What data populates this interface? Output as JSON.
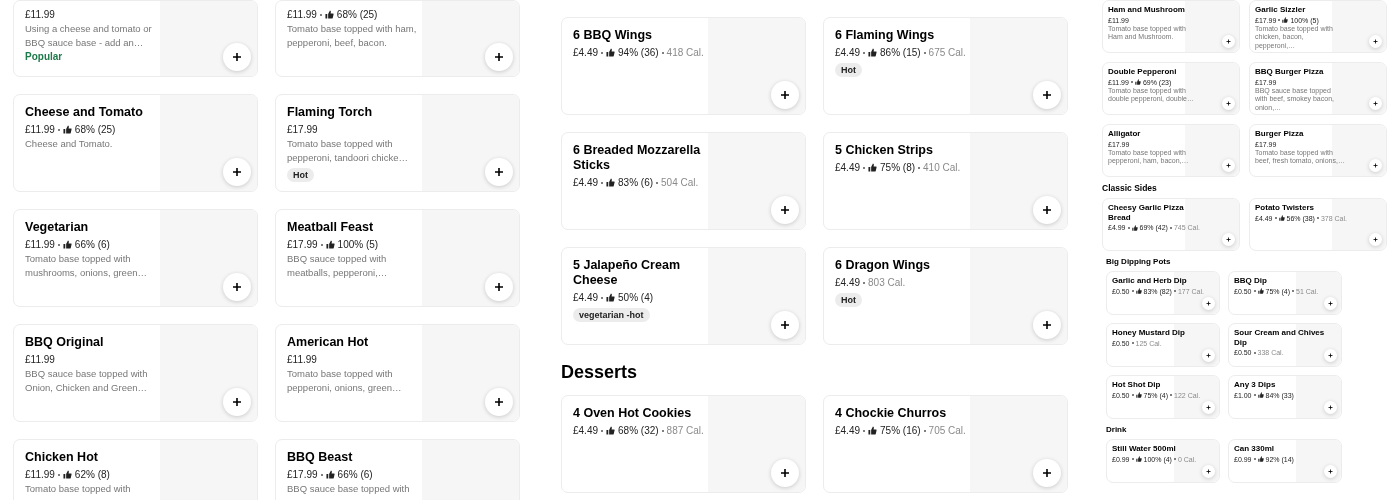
{
  "panels": [
    {
      "kind": "full",
      "sections": [
        {
          "kind": "wide",
          "items": [
            {
              "price": "£11.99",
              "description": "Using a cheese and tomato or BBQ sauce base - add an…",
              "tags": [
                {
                  "label": "Popular",
                  "kind": "highlight"
                }
              ]
            },
            {
              "price": "£11.99",
              "rating": "68% (25)",
              "description": "Tomato base topped with ham, pepperoni, beef, bacon."
            },
            {
              "title": "Cheese and Tomato",
              "price": "£11.99",
              "rating": "68% (25)",
              "description": "Cheese and Tomato."
            },
            {
              "title": "Flaming Torch",
              "price": "£17.99",
              "description": "Tomato base topped with pepperoni, tandoori chicke…",
              "tags": [
                {
                  "label": "Hot",
                  "kind": "badge"
                }
              ]
            },
            {
              "title": "Vegetarian",
              "price": "£11.99",
              "rating": "66% (6)",
              "description": "Tomato base topped with mushrooms, onions, green…"
            },
            {
              "title": "Meatball Feast",
              "price": "£17.99",
              "rating": "100% (5)",
              "description": "BBQ sauce topped with meatballs, pepperoni,…"
            },
            {
              "title": "BBQ Original",
              "price": "£11.99",
              "description": "BBQ sauce base topped with Onion, Chicken and Green…"
            },
            {
              "title": "American Hot",
              "price": "£11.99",
              "description": "Tomato base topped with pepperoni, onions, green…"
            },
            {
              "title": "Chicken Hot",
              "price": "£11.99",
              "rating": "62% (8)",
              "description": "Tomato base topped with"
            },
            {
              "title": "BBQ Beast",
              "price": "£17.99",
              "rating": "66% (6)",
              "description": "BBQ sauce base topped with"
            }
          ]
        }
      ]
    },
    {
      "kind": "full",
      "sections": [
        {
          "kind": "wide",
          "items": [
            {
              "title": "6 BBQ Wings",
              "price": "£4.49",
              "rating": "94% (36)",
              "calories": "418 Cal."
            },
            {
              "title": "6 Flaming Wings",
              "price": "£4.49",
              "rating": "86% (15)",
              "calories": "675 Cal.",
              "tags": [
                {
                  "label": "Hot",
                  "kind": "badge"
                }
              ]
            },
            {
              "title": "6 Breaded Mozzarella Sticks",
              "price": "£4.49",
              "rating": "83% (6)",
              "calories": "504 Cal."
            },
            {
              "title": "5 Chicken Strips",
              "price": "£4.49",
              "rating": "75% (8)",
              "calories": "410 Cal."
            },
            {
              "title": "5 Jalapeño Cream Cheese",
              "price": "£4.49",
              "rating": "50% (4)",
              "tags": [
                {
                  "label": "vegetarian -hot",
                  "kind": "badge"
                }
              ]
            },
            {
              "title": "6 Dragon Wings",
              "price": "£4.49",
              "calories": "803 Cal.",
              "tags": [
                {
                  "label": "Hot",
                  "kind": "badge"
                }
              ]
            }
          ]
        },
        {
          "heading": "Desserts",
          "kind": "wide",
          "items": [
            {
              "title": "4 Oven Hot Cookies",
              "price": "£4.49",
              "rating": "68% (32)",
              "calories": "887 Cal."
            },
            {
              "title": "4 Chockie Churros",
              "price": "£4.49",
              "rating": "75% (16)",
              "calories": "705 Cal."
            }
          ]
        }
      ]
    },
    {
      "kind": "thumbnail",
      "sections": [
        {
          "kind": "wide",
          "items": [
            {
              "title": "Ham and Mushroom",
              "price": "£11.99",
              "description": "Tomato base topped with Ham and Mushroom."
            },
            {
              "title": "Garlic Sizzler",
              "price": "£17.99",
              "rating": "100% (5)",
              "description": "Tomato base topped with chicken, bacon, pepperoni,…"
            },
            {
              "title": "Double Pepperoni",
              "price": "£11.99",
              "rating": "69% (23)",
              "description": "Tomato base topped with double pepperoni, double…"
            },
            {
              "title": "BBQ Burger Pizza",
              "price": "£17.99",
              "description": "BBQ sauce base topped with beef, smokey bacon, onion,…"
            },
            {
              "title": "Alligator",
              "price": "£17.99",
              "description": "Tomato base topped with pepperoni, ham, bacon,…"
            },
            {
              "title": "Burger Pizza",
              "price": "£17.99",
              "description": "Tomato base topped with beef, fresh tomato, onions,…"
            }
          ]
        },
        {
          "heading": "Classic Sides",
          "kind": "wide",
          "items": [
            {
              "title": "Cheesy Garlic Pizza Bread",
              "price": "£4.99",
              "rating": "69% (42)",
              "calories": "745 Cal."
            },
            {
              "title": "Potato Twisters",
              "price": "£4.49",
              "rating": "56% (38)",
              "calories": "378 Cal."
            }
          ]
        },
        {
          "heading": "Big Dipping Pots",
          "kind": "narrow",
          "items": [
            {
              "title": "Garlic and Herb Dip",
              "price": "£0.50",
              "rating": "83% (82)",
              "calories": "177 Cal."
            },
            {
              "title": "BBQ Dip",
              "price": "£0.50",
              "rating": "75% (4)",
              "calories": "51 Cal."
            },
            {
              "title": "Honey Mustard Dip",
              "price": "£0.50",
              "calories": "125 Cal."
            },
            {
              "title": "Sour Cream and Chives Dip",
              "price": "£0.50",
              "calories": "338 Cal."
            },
            {
              "title": "Hot Shot Dip",
              "price": "£0.50",
              "rating": "75% (4)",
              "calories": "122 Cal."
            },
            {
              "title": "Any 3 Dips",
              "price": "£1.00",
              "rating": "84% (33)"
            }
          ]
        },
        {
          "heading": "Drink",
          "kind": "narrow",
          "items": [
            {
              "title": "Still Water 500ml",
              "price": "£0.99",
              "rating": "100% (4)",
              "calories": "0 Cal."
            },
            {
              "title": "Can 330ml",
              "price": "£0.99",
              "rating": "92% (14)"
            }
          ]
        }
      ]
    }
  ]
}
